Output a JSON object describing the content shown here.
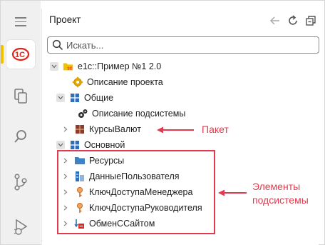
{
  "panel": {
    "title": "Проект"
  },
  "search": {
    "placeholder": "Искать..."
  },
  "tree": {
    "root": "e1c::Пример №1 2.0",
    "project_desc": "Описание проекта",
    "general": "Общие",
    "subsystem_desc": "Описание подсистемы",
    "currency_rates": "КурсыВалют",
    "main": "Основной",
    "resources": "Ресурсы",
    "user_data": "ДанныеПользователя",
    "manager_key": "КлючДоступаМенеджера",
    "head_key": "КлючДоступаРуководителя",
    "site_exchange": "ОбменССайтом"
  },
  "annotations": {
    "package": "Пакет",
    "subsystem_elements_line1": "Элементы",
    "subsystem_elements_line2": "подсистемы"
  },
  "colors": {
    "accent": "#f2c200",
    "annotation": "#e23b4f"
  },
  "icons": {
    "activity": [
      "menu-icon",
      "1c-logo-icon",
      "files-icon",
      "search-icon",
      "source-control-icon",
      "run-debug-icon"
    ],
    "toolbar": [
      "back-arrow-icon",
      "refresh-icon",
      "collapse-all-icon"
    ]
  }
}
